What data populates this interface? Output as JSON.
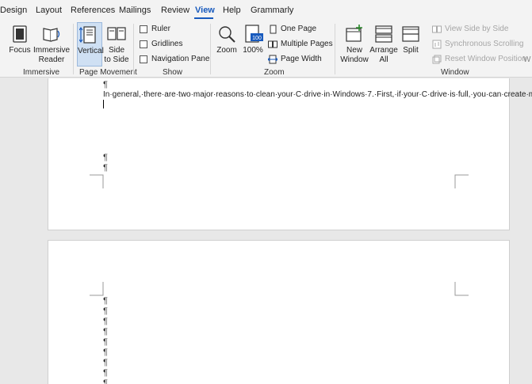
{
  "menu": {
    "tabs": [
      "Design",
      "Layout",
      "References",
      "Mailings",
      "Review",
      "View",
      "Help",
      "Grammarly"
    ],
    "active": "View"
  },
  "ribbon": {
    "immersive": {
      "label": "Immersive",
      "focus": "Focus",
      "immersive_reader": "Immersive\nReader"
    },
    "page_movement": {
      "label": "Page Movement",
      "vertical": "Vertical",
      "side_to_side": "Side\nto Side"
    },
    "show": {
      "label": "Show",
      "ruler": "Ruler",
      "gridlines": "Gridlines",
      "navigation_pane": "Navigation Pane"
    },
    "zoom": {
      "label": "Zoom",
      "zoom": "Zoom",
      "zoom_100": "100%",
      "zoom_badge": "100",
      "one_page": "One Page",
      "multiple_pages": "Multiple Pages",
      "page_width": "Page Width"
    },
    "window": {
      "label": "Window",
      "new_window": "New\nWindow",
      "arrange_all": "Arrange\nAll",
      "split": "Split",
      "view_side_by_side": "View Side by Side",
      "synchronous_scrolling": "Synchronous Scrolling",
      "reset_window_position": "Reset Window Position",
      "truncated": "W"
    }
  },
  "document": {
    "pilcrow": "¶",
    "body_text": "In·general,·there·are·two·major·reasons·to·clean·your·C·drive·in·Windows·7.·First,·if·your·C·drive·is·full,·you·can·create·more·space·on·your·PC.·Finally,·the·entire·data·on·the·C·drive·should·be·erased·so·that·it·cannot·be·recovered·later.·The·primary·reason·to·wipe·your·C·drive·is·for·privacy·reasons;·if·you·want·to·sell·your·computer·or·laptop,·you·don't·want·any·trace·of·your·previous·data·as·it·may·compromise·your·privacy.·These·are·the·two·major·choices·basic·Windows·7·users·go·through·while·trying·to·free·up·more·space.·In·this·article,·we're·going·to·discuss·both·choices·in·brief."
  },
  "colors": {
    "accent": "#185abd",
    "ribbon_bg": "#f3f3f3",
    "doc_bg": "#e8e8e8",
    "disabled": "#a6a6a6"
  }
}
